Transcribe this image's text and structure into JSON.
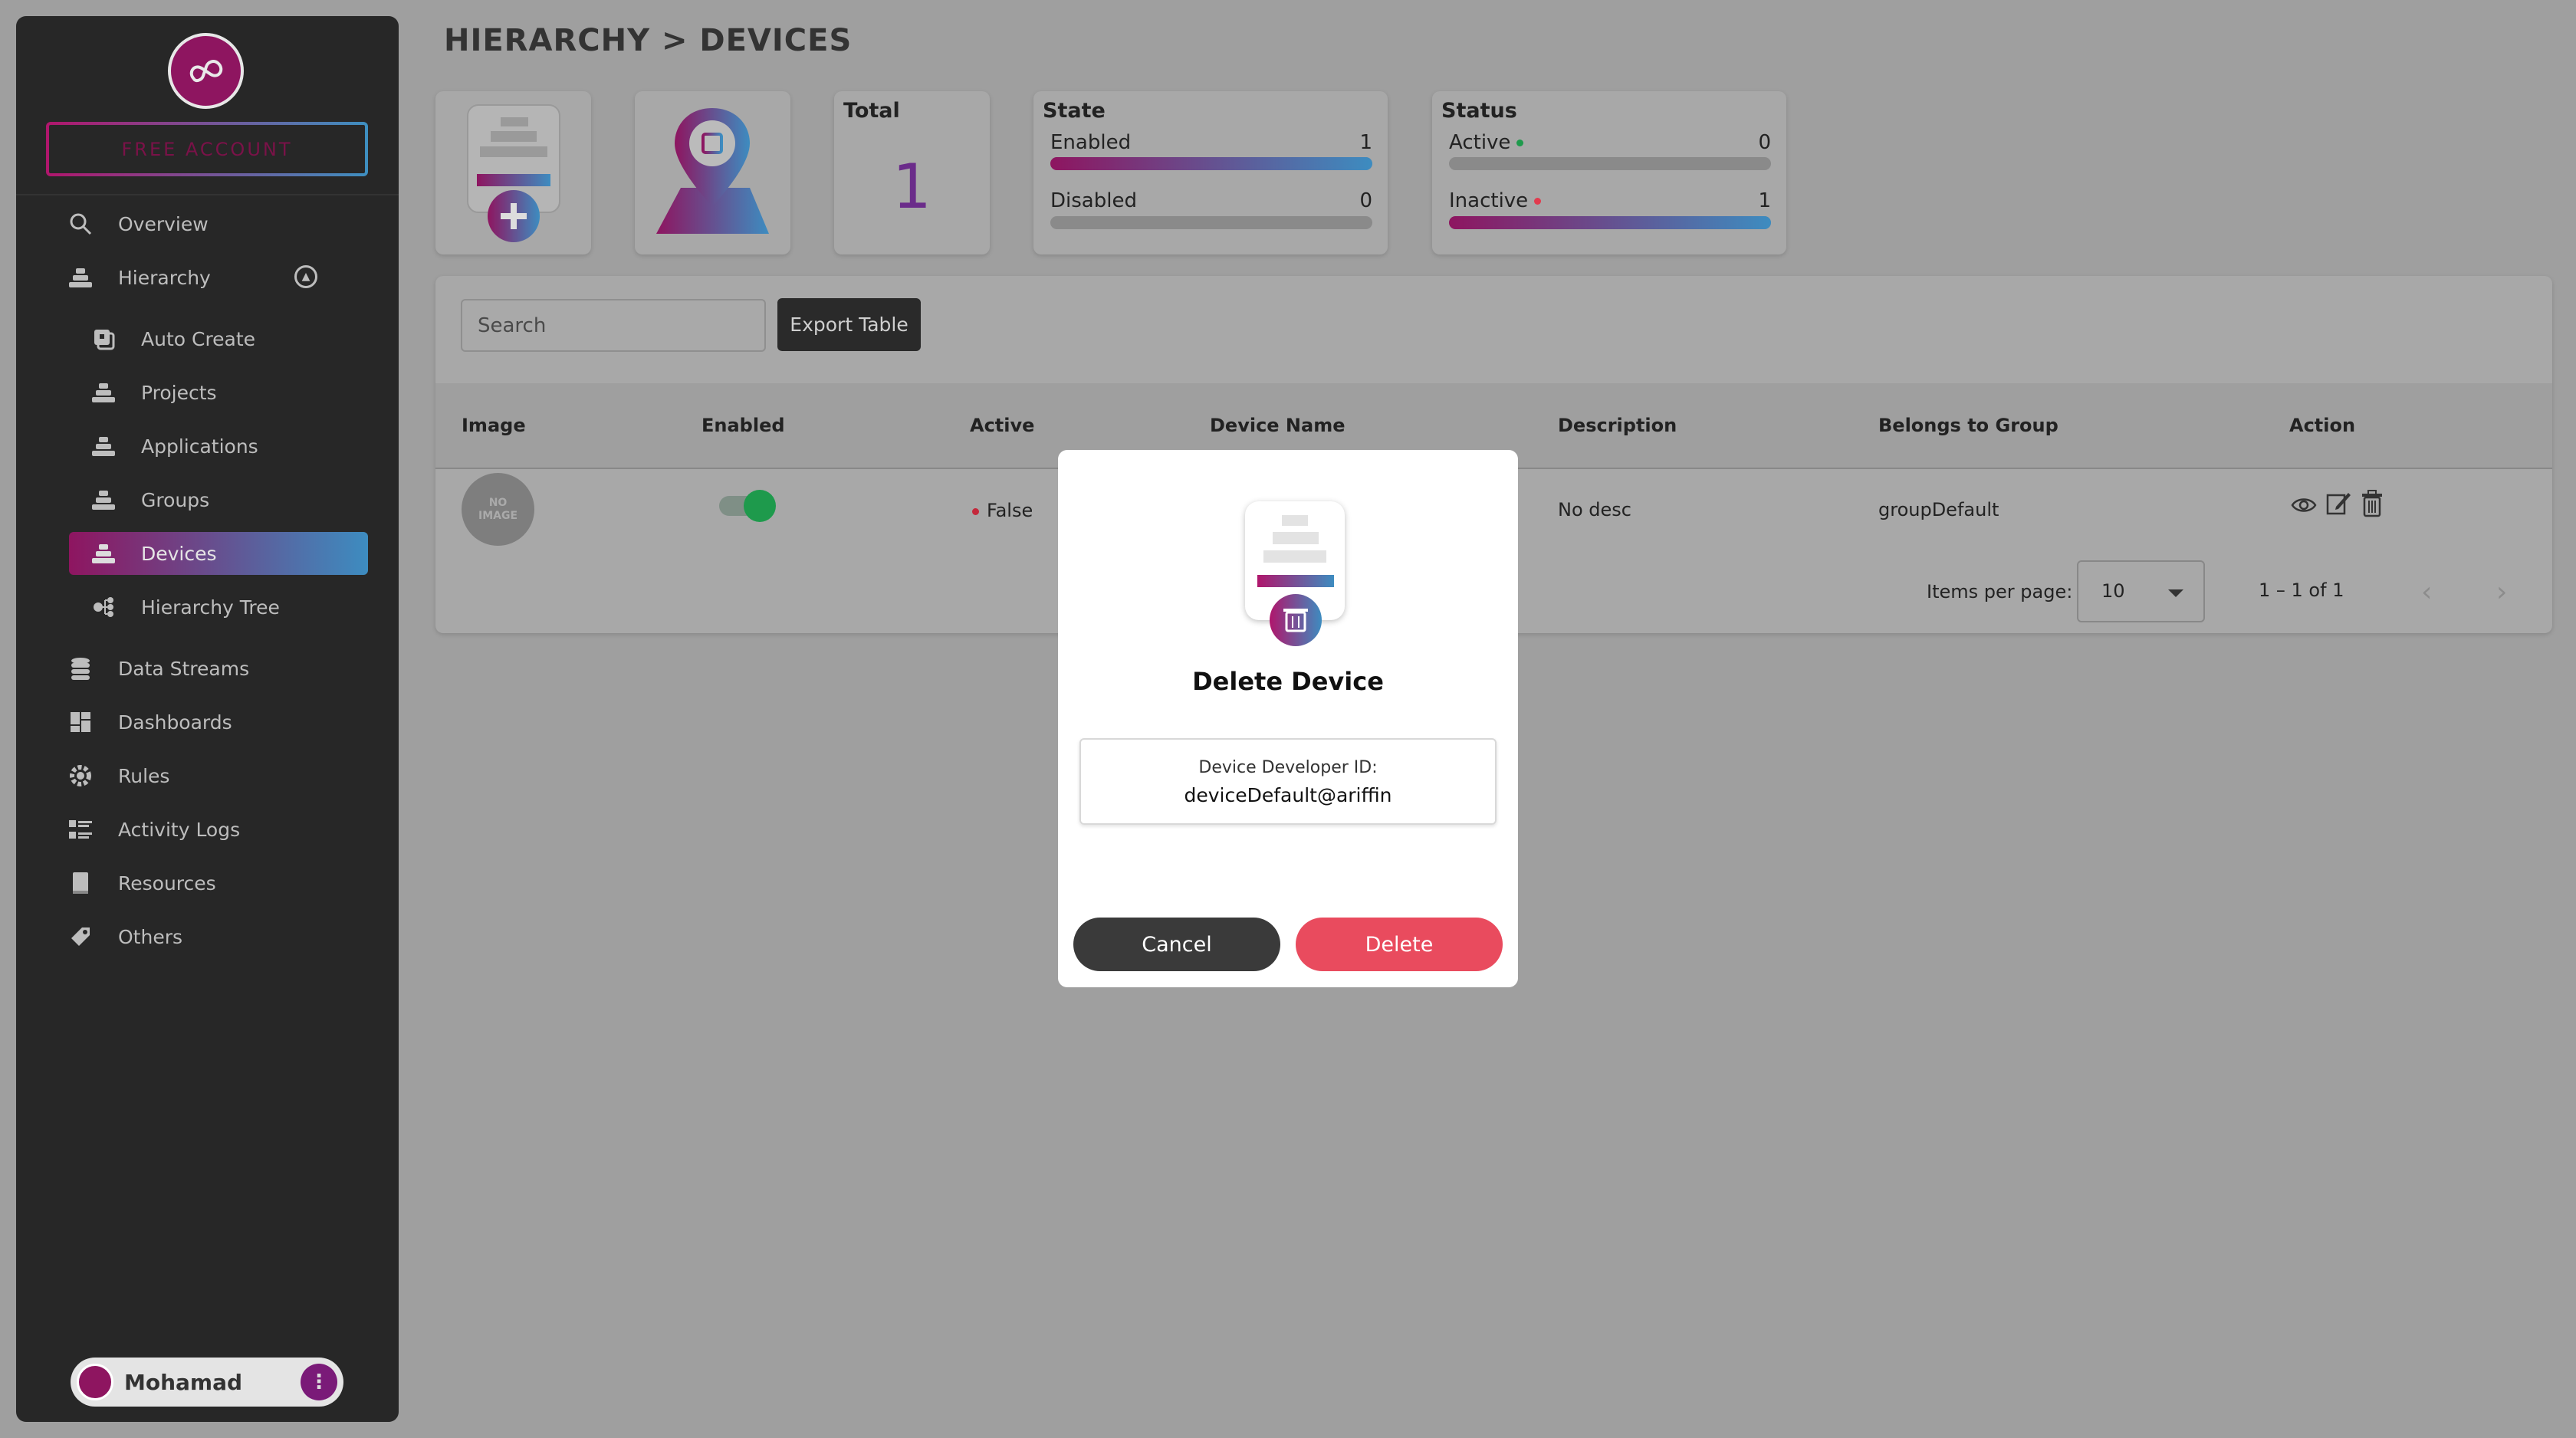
{
  "sidebar": {
    "free_account": "FREE ACCOUNT",
    "items": [
      {
        "label": "Overview",
        "icon": "search-icon"
      },
      {
        "label": "Hierarchy",
        "icon": "hierarchy-icon"
      },
      {
        "label": "Auto Create",
        "icon": "auto-create-icon"
      },
      {
        "label": "Projects",
        "icon": "stack-icon"
      },
      {
        "label": "Applications",
        "icon": "stack-icon"
      },
      {
        "label": "Groups",
        "icon": "stack-icon"
      },
      {
        "label": "Devices",
        "icon": "stack-icon",
        "active": true
      },
      {
        "label": "Hierarchy Tree",
        "icon": "tree-icon"
      },
      {
        "label": "Data Streams",
        "icon": "database-icon"
      },
      {
        "label": "Dashboards",
        "icon": "dashboard-icon"
      },
      {
        "label": "Rules",
        "icon": "gear-icon"
      },
      {
        "label": "Activity Logs",
        "icon": "list-icon"
      },
      {
        "label": "Resources",
        "icon": "book-icon"
      },
      {
        "label": "Others",
        "icon": "tag-icon"
      }
    ],
    "user": {
      "name": "Mohamad",
      "menu_glyph": "⋮"
    }
  },
  "header": {
    "title": "HIERARCHY > DEVICES"
  },
  "summary": {
    "total": {
      "title": "Total",
      "value": "1"
    },
    "state": {
      "title": "State",
      "rows": [
        {
          "label": "Enabled",
          "value": "1",
          "fraction": 1
        },
        {
          "label": "Disabled",
          "value": "0",
          "fraction": 0
        }
      ]
    },
    "status": {
      "title": "Status",
      "rows": [
        {
          "label": "Active",
          "value": "0",
          "fraction": 0,
          "dot_color": "#1e9a4c"
        },
        {
          "label": "Inactive",
          "value": "1",
          "fraction": 1,
          "dot_color": "#e23b4e"
        }
      ]
    }
  },
  "table": {
    "search_placeholder": "Search",
    "export_label": "Export Table",
    "columns": [
      "Image",
      "Enabled",
      "Active",
      "Device Name",
      "Description",
      "Belongs to Group",
      "Action"
    ],
    "rows": [
      {
        "image_placeholder_line1": "NO",
        "image_placeholder_line2": "IMAGE",
        "enabled": true,
        "active": "False",
        "description": "No desc",
        "group": "groupDefault"
      }
    ],
    "paginator": {
      "items_per_page_label": "Items per page:",
      "page_size": "10",
      "range": "1 – 1 of 1"
    }
  },
  "modal": {
    "title": "Delete Device",
    "info_label": "Device Developer ID:",
    "info_value": "deviceDefault@ariffin",
    "cancel_label": "Cancel",
    "delete_label": "Delete"
  },
  "colors": {
    "accent_start": "#8e1560",
    "accent_end": "#3d8cc0",
    "danger": "#e94b5e",
    "success": "#1e9a4c"
  }
}
